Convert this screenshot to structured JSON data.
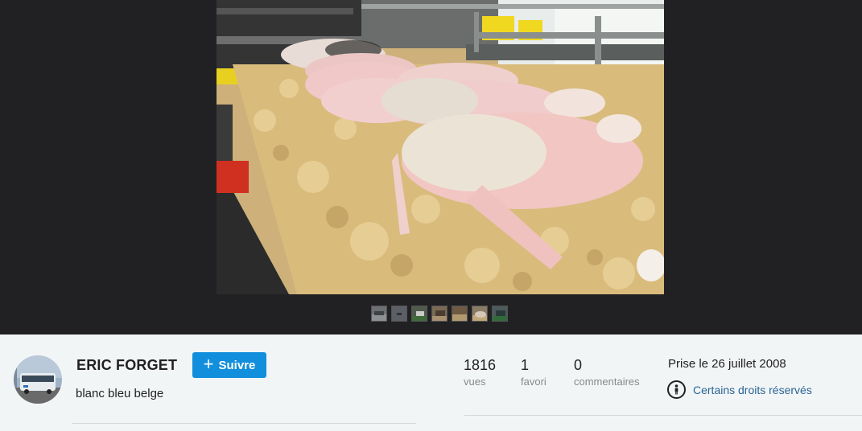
{
  "author": {
    "name": "ERIC FORGET",
    "avatar_icon": "avatar-bus-photo"
  },
  "follow_button": {
    "label": "Suivre",
    "icon": "plus-icon",
    "color": "#128fdc"
  },
  "photo": {
    "title": "blanc bleu belge",
    "date_taken": "Prise le 26 juillet 2008"
  },
  "stats": {
    "views": {
      "value": "1816",
      "label": "vues"
    },
    "faves": {
      "value": "1",
      "label": "favori"
    },
    "comments": {
      "value": "0",
      "label": "commentaires"
    }
  },
  "license": {
    "label": "Certains droits réservés",
    "icon": "license-person-icon"
  },
  "filmstrip": {
    "thumbnails": [
      "thumb-1",
      "thumb-2",
      "thumb-3",
      "thumb-4",
      "thumb-5",
      "thumb-6",
      "thumb-7"
    ]
  },
  "colors": {
    "viewer_bg": "#212124",
    "info_bg": "#f2f5f6",
    "accent": "#128fdc",
    "link": "#2a6496"
  }
}
